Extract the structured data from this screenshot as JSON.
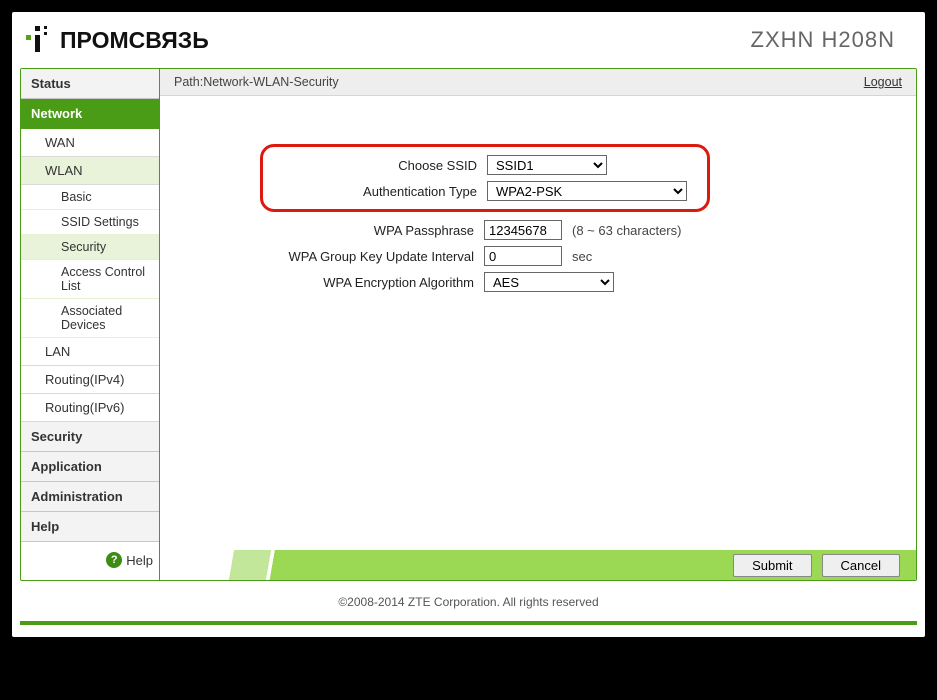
{
  "header": {
    "brand": "ПРОМСВЯЗЬ",
    "model": "ZXHN H208N"
  },
  "sidebar": {
    "items": [
      {
        "label": "Status",
        "type": "top"
      },
      {
        "label": "Network",
        "type": "top",
        "active": true
      },
      {
        "label": "WAN",
        "type": "sub"
      },
      {
        "label": "WLAN",
        "type": "sub",
        "green": true
      },
      {
        "label": "Basic",
        "type": "sub2"
      },
      {
        "label": "SSID Settings",
        "type": "sub2"
      },
      {
        "label": "Security",
        "type": "sub2",
        "selected": true
      },
      {
        "label": "Access Control List",
        "type": "sub2"
      },
      {
        "label": "Associated Devices",
        "type": "sub2"
      },
      {
        "label": "LAN",
        "type": "sub"
      },
      {
        "label": "Routing(IPv4)",
        "type": "sub"
      },
      {
        "label": "Routing(IPv6)",
        "type": "sub"
      },
      {
        "label": "Security",
        "type": "top"
      },
      {
        "label": "Application",
        "type": "top"
      },
      {
        "label": "Administration",
        "type": "top"
      },
      {
        "label": "Help",
        "type": "top"
      }
    ],
    "help_label": "Help"
  },
  "path": {
    "prefix": "Path:",
    "value": "Network-WLAN-Security",
    "logout": "Logout"
  },
  "form": {
    "choose_ssid_label": "Choose SSID",
    "choose_ssid_value": "SSID1",
    "auth_type_label": "Authentication Type",
    "auth_type_value": "WPA2-PSK",
    "passphrase_label": "WPA Passphrase",
    "passphrase_value": "12345678",
    "passphrase_hint": "(8 ~ 63 characters)",
    "group_key_label": "WPA Group Key Update Interval",
    "group_key_value": "0",
    "group_key_unit": "sec",
    "enc_alg_label": "WPA Encryption Algorithm",
    "enc_alg_value": "AES"
  },
  "buttons": {
    "submit": "Submit",
    "cancel": "Cancel"
  },
  "footer": "©2008-2014 ZTE Corporation. All rights reserved"
}
